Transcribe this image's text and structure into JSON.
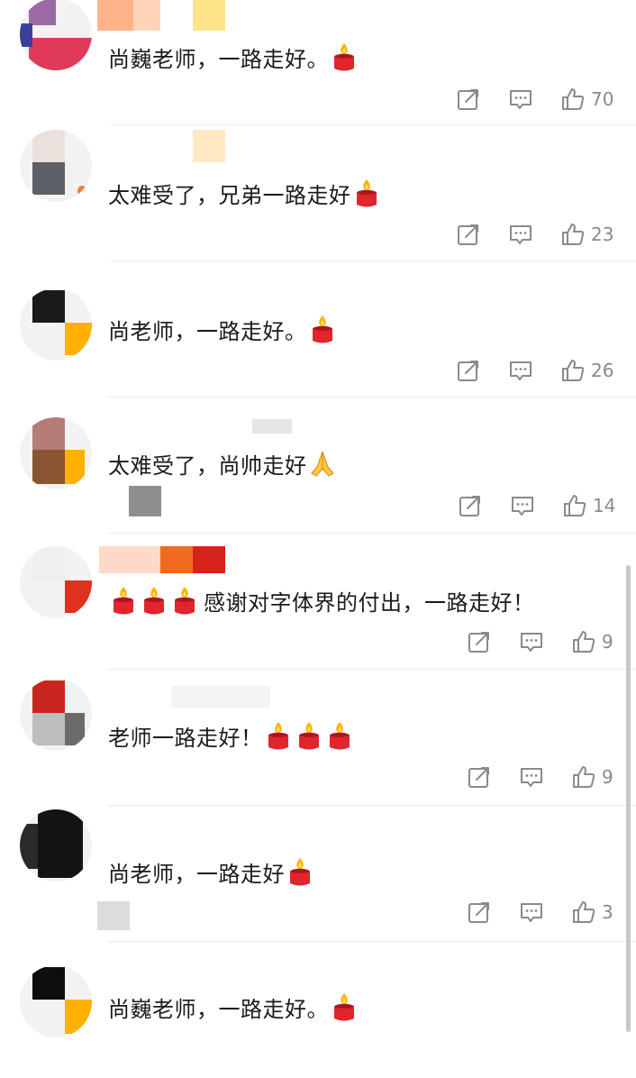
{
  "comments": [
    {
      "text": "尚巍老师，一路走好。",
      "trail": "candle",
      "likes": "70"
    },
    {
      "text": "太难受了，兄弟一路走好",
      "trail": "candle",
      "likes": "23"
    },
    {
      "text": "尚老师，一路走好。",
      "trail": "candle",
      "likes": "26"
    },
    {
      "text": "太难受了，尚帅走好",
      "trail": "pray",
      "likes": "14"
    },
    {
      "lead": "candle3",
      "text": "感谢对字体界的付出，一路走好！",
      "likes": "9"
    },
    {
      "text": "老师一路走好！",
      "trail": "candle3",
      "likes": "9"
    },
    {
      "text": "尚老师，一路走好",
      "trail": "candle",
      "likes": "3"
    },
    {
      "text": "尚巍老师，一路走好。",
      "trail": "candle",
      "likes": ""
    }
  ],
  "icons": {
    "share": "share-icon",
    "reply": "comment-icon",
    "like": "thumbs-up-icon",
    "candle": "candle-emoji",
    "pray": "folded-hands-emoji"
  },
  "colors": {
    "text": "#1a1a1a",
    "meta": "#8a8a8a",
    "candle_red": "#e0262c",
    "flame": "#ffb300",
    "divider": "#ececec"
  }
}
